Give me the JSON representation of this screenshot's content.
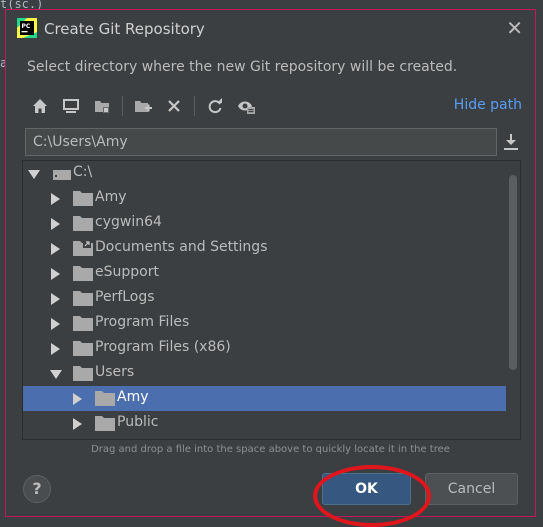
{
  "background": {
    "editor_text_1": "t(sc.)",
    "editor_text_2": "a"
  },
  "dialog": {
    "title": "Create Git Repository",
    "description": "Select directory where the new Git repository will be created.",
    "close_icon": "close-icon"
  },
  "toolbar": {
    "buttons": [
      "home-icon",
      "desktop-icon",
      "project-folder-icon",
      "new-folder-icon",
      "delete-icon",
      "refresh-icon",
      "show-hidden-icon"
    ],
    "hide_path_label": "Hide path"
  },
  "path": {
    "value": "C:\\Users\\Amy"
  },
  "tree": {
    "root": "C:\\",
    "items": [
      {
        "label": "Amy"
      },
      {
        "label": "cygwin64"
      },
      {
        "label": "Documents and Settings"
      },
      {
        "label": "eSupport"
      },
      {
        "label": "PerfLogs"
      },
      {
        "label": "Program Files"
      },
      {
        "label": "Program Files (x86)"
      },
      {
        "label": "Users"
      },
      {
        "label": "Amy"
      },
      {
        "label": "Public"
      }
    ]
  },
  "hint": "Drag and drop a file into the space above to quickly locate it in the tree",
  "buttons": {
    "help": "?",
    "ok": "OK",
    "cancel": "Cancel"
  },
  "colors": {
    "accent": "#365880",
    "selection": "#4b6eaf",
    "link": "#589df6",
    "highlight_circle": "#e3151c"
  }
}
